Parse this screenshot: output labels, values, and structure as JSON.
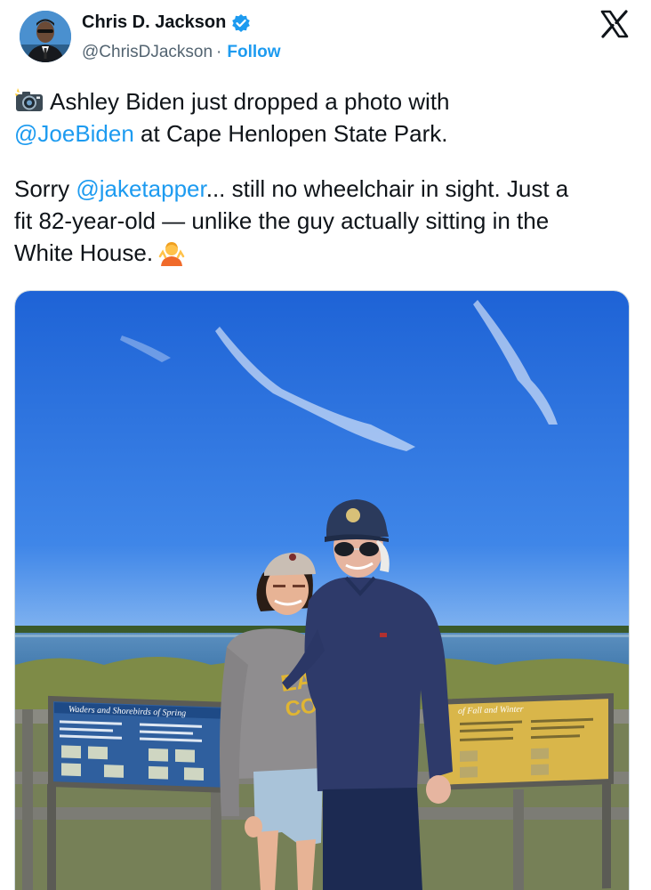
{
  "author": {
    "display_name": "Chris D. Jackson",
    "handle": "@ChrisDJackson",
    "separator": "·",
    "follow_label": "Follow",
    "verified_color": "#1d9bf0"
  },
  "tweet": {
    "lines": [
      {
        "before": "",
        "mention": "",
        "after": "Ashley Biden just dropped a photo with",
        "emoji": "camera-flash-emoji"
      },
      {
        "before": "",
        "mention": "@JoeBiden",
        "after": " at Cape Henlopen State Park."
      },
      {
        "before": "Sorry ",
        "mention": "@jaketapper",
        "after": "... still no wheelchair in sight. Just a"
      },
      {
        "before": "",
        "mention": "",
        "after": "fit 82-year-old — unlike the guy actually sitting in the"
      },
      {
        "before": "",
        "mention": "",
        "after": "White House.",
        "emoji": "person-shrugging-emoji"
      }
    ]
  },
  "photo": {
    "sign_left_title": "Waders and Shorebirds of Spring",
    "sign_right_title": "of Fall and Winter",
    "shirt_text_1": "EAS",
    "shirt_text_2": "CO"
  },
  "colors": {
    "link": "#1d9bf0",
    "text": "#0f1419",
    "secondary": "#536471",
    "sky_top": "#1e63d6",
    "sky_bottom": "#6fa6ee"
  },
  "icons": {
    "close": "x-logo-icon",
    "verified": "verified-badge-icon"
  }
}
